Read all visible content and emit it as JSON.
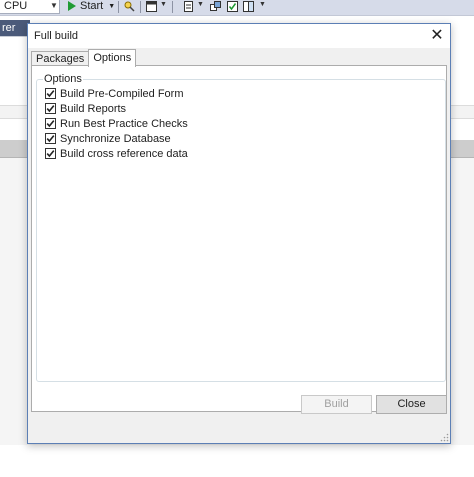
{
  "ide": {
    "config_combo": "CPU",
    "start_label": "Start",
    "side_tab": "rer"
  },
  "dialog": {
    "title": "Full build",
    "tabs": [
      {
        "label": "Packages",
        "active": false
      },
      {
        "label": "Options",
        "active": true
      }
    ],
    "group_label": "Options",
    "options": [
      {
        "label": "Build Pre-Compiled Form",
        "checked": true
      },
      {
        "label": "Build Reports",
        "checked": true
      },
      {
        "label": "Run Best Practice Checks",
        "checked": true
      },
      {
        "label": "Synchronize Database",
        "checked": true
      },
      {
        "label": "Build cross reference data",
        "checked": true
      }
    ],
    "build_label": "Build",
    "close_label": "Close"
  },
  "colors": {
    "accent_border": "#5c7fb5",
    "play_green": "#1f9b34",
    "tab_blue": "#4b5a7a"
  },
  "icons": [
    "play-icon",
    "close-icon",
    "checkmark-icon",
    "resize-grip-icon"
  ]
}
